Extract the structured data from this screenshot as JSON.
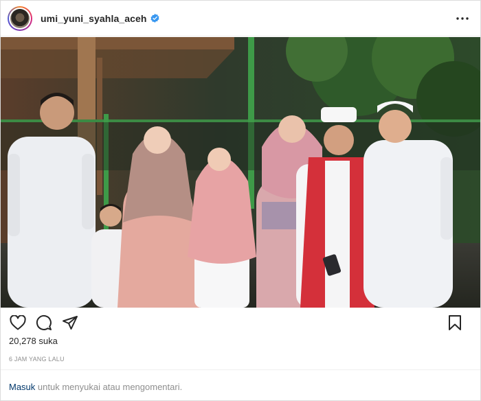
{
  "post": {
    "username": "umi_yuni_syahla_aceh",
    "likes_text": "20,278 suka",
    "time_text": "6 JAM YANG LALU",
    "login_link": "Masuk",
    "login_text": " untuk menyukai atau mengomentari."
  },
  "icons": {
    "avatar": "profile-avatar",
    "verified": "verified-badge-icon",
    "more": "more-options-icon",
    "like": "heart-icon",
    "comment": "comment-icon",
    "share": "share-icon",
    "save": "bookmark-icon"
  },
  "colors": {
    "verified": "#3897f0",
    "link": "#00376b",
    "muted": "#8e8e8e"
  }
}
